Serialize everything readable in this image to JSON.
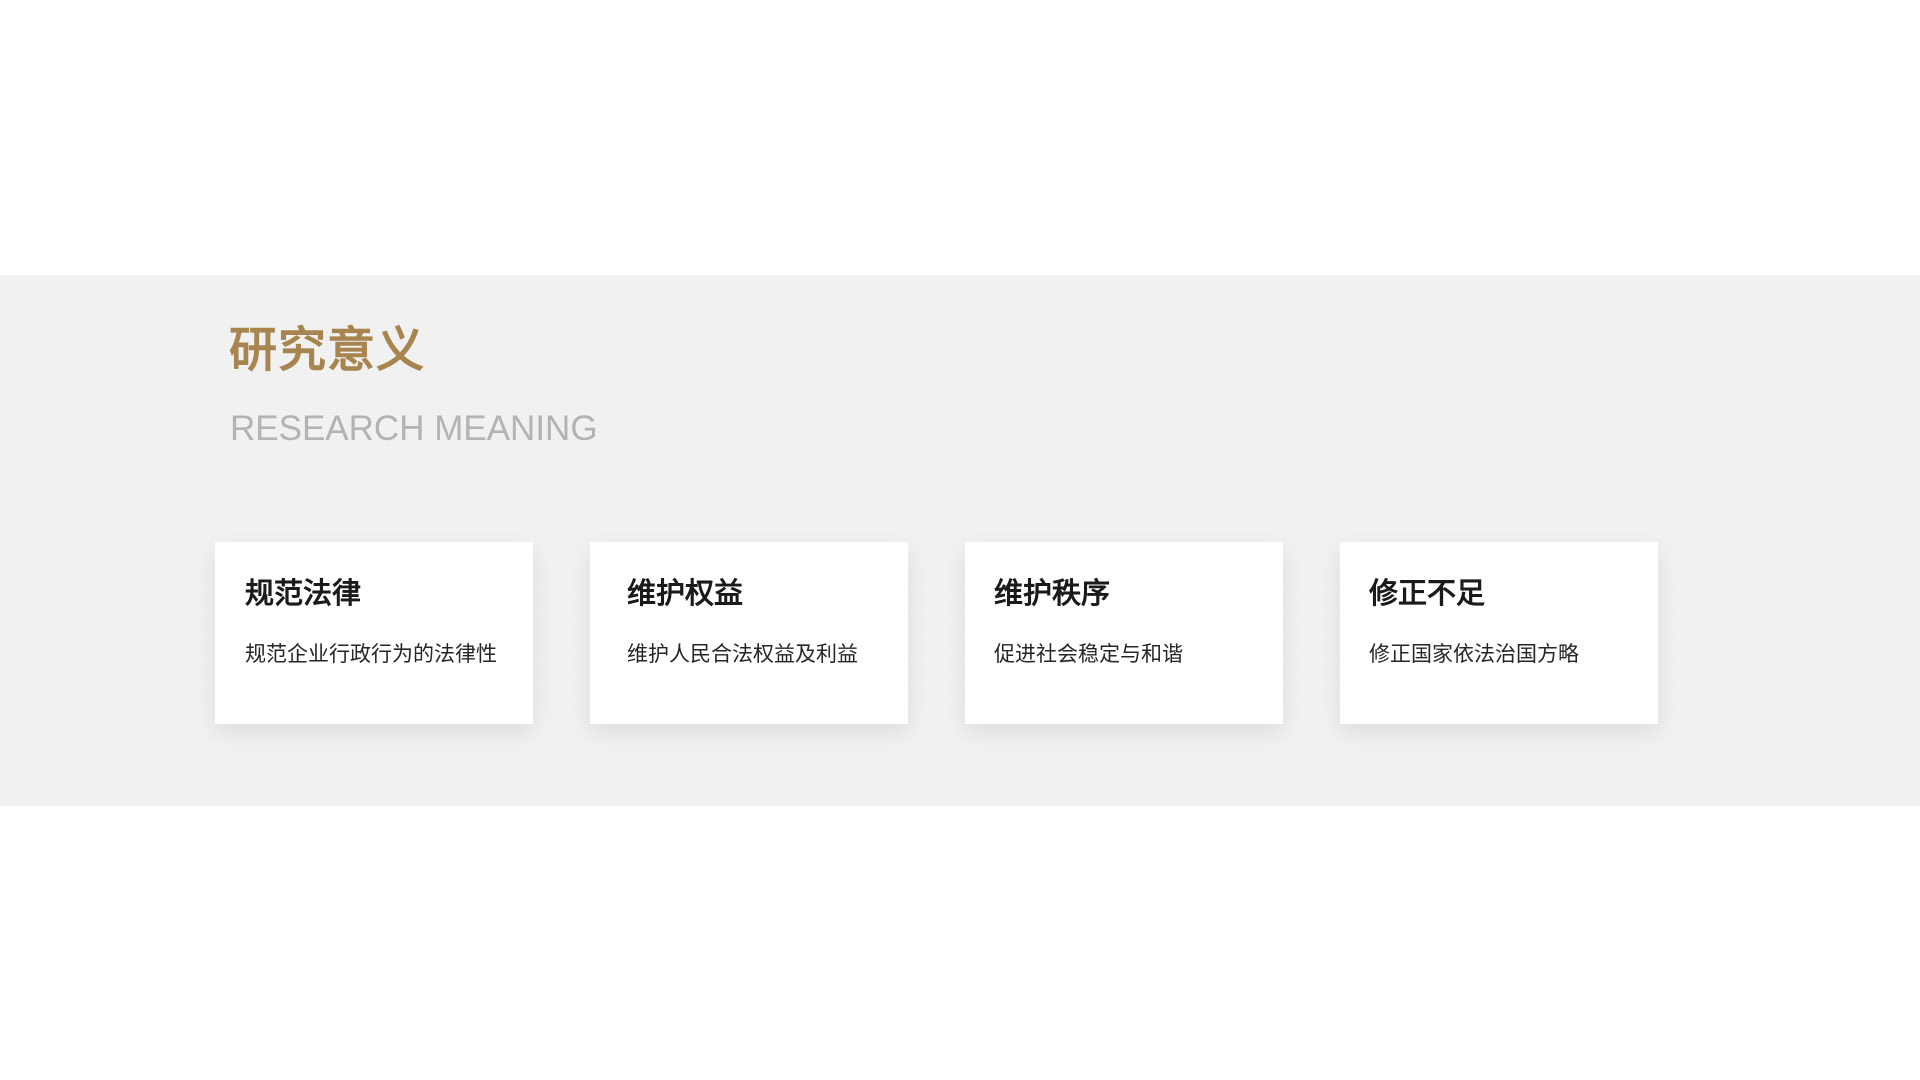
{
  "slide": {
    "title": "研究意义",
    "subtitle": "RESEARCH MEANING",
    "accent_color": "#a8844e",
    "cards": [
      {
        "title": "规范法律",
        "text": "规范企业行政行为的法律性"
      },
      {
        "title": "维护权益",
        "text": "维护人民合法权益及利益"
      },
      {
        "title": "维护秩序",
        "text": "促进社会稳定与和谐"
      },
      {
        "title": "修正不足",
        "text": "修正国家依法治国方略"
      }
    ]
  }
}
